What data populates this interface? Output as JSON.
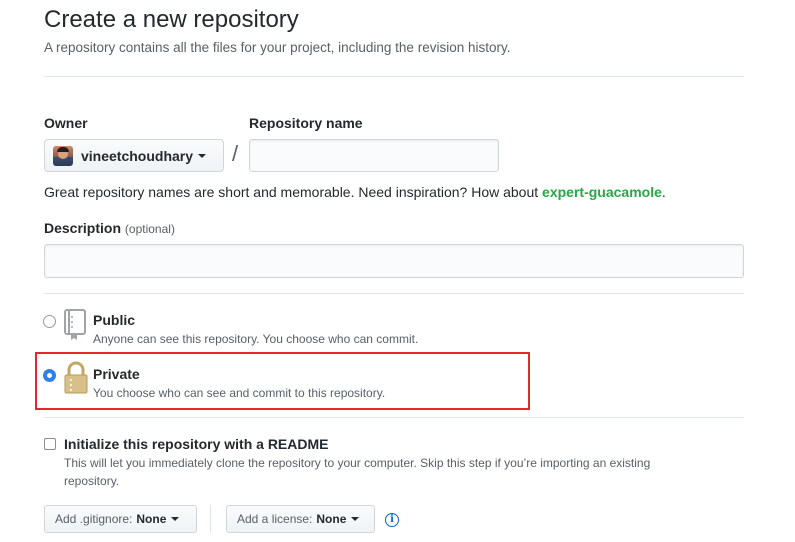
{
  "header": {
    "title": "Create a new repository",
    "subtitle": "A repository contains all the files for your project, including the revision history."
  },
  "owner": {
    "label": "Owner",
    "value": "vineetchoudhary"
  },
  "repo_name": {
    "label": "Repository name",
    "value": "",
    "separator": "/"
  },
  "hint": {
    "text": "Great repository names are short and memorable. Need inspiration? How about ",
    "suggestion": "expert-guacamole",
    "end": "."
  },
  "description": {
    "label": "Description",
    "optional": "(optional)",
    "value": ""
  },
  "visibility": {
    "public": {
      "title": "Public",
      "desc": "Anyone can see this repository. You choose who can commit.",
      "selected": false
    },
    "private": {
      "title": "Private",
      "desc": "You choose who can see and commit to this repository.",
      "selected": true
    }
  },
  "readme": {
    "title": "Initialize this repository with a README",
    "desc_line1": "This will let you immediately clone the repository to your computer. Skip this step if you’re importing an existing",
    "desc_line2": "repository.",
    "checked": false
  },
  "gitignore": {
    "prefix": "Add .gitignore:",
    "value": "None"
  },
  "license": {
    "prefix": "Add a license:",
    "value": "None"
  },
  "info_icon": "i",
  "colors": {
    "accent_green": "#28a745",
    "radio_blue": "#2f80ed",
    "highlight_red": "#e0282e"
  }
}
